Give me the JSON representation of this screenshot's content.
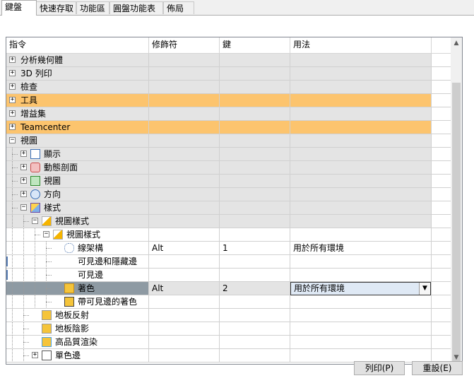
{
  "tabs": [
    {
      "label": "鍵盤"
    },
    {
      "label": "快速存取"
    },
    {
      "label": "功能區"
    },
    {
      "label": "圓盤功能表"
    },
    {
      "label": "佈局"
    }
  ],
  "columns": [
    "指令",
    "修飾符",
    "鍵",
    "用法"
  ],
  "rows": [
    {
      "label": "分析幾何體",
      "modifier": "",
      "key": "",
      "usage": ""
    },
    {
      "label": "3D 列印",
      "modifier": "",
      "key": "",
      "usage": ""
    },
    {
      "label": "檢查",
      "modifier": "",
      "key": "",
      "usage": ""
    },
    {
      "label": "工具",
      "modifier": "",
      "key": "",
      "usage": ""
    },
    {
      "label": "增益集",
      "modifier": "",
      "key": "",
      "usage": ""
    },
    {
      "label": "Teamcenter",
      "modifier": "",
      "key": "",
      "usage": ""
    },
    {
      "label": "視圖",
      "modifier": "",
      "key": "",
      "usage": ""
    },
    {
      "label": "顯示",
      "modifier": "",
      "key": "",
      "usage": ""
    },
    {
      "label": "動態剖面",
      "modifier": "",
      "key": "",
      "usage": ""
    },
    {
      "label": "視圖",
      "modifier": "",
      "key": "",
      "usage": ""
    },
    {
      "label": "方向",
      "modifier": "",
      "key": "",
      "usage": ""
    },
    {
      "label": "樣式",
      "modifier": "",
      "key": "",
      "usage": ""
    },
    {
      "label": "視圖樣式",
      "modifier": "",
      "key": "",
      "usage": ""
    },
    {
      "label": "視圖樣式",
      "modifier": "",
      "key": "",
      "usage": ""
    },
    {
      "label": "線架構",
      "modifier": "Alt",
      "key": "1",
      "usage": "用於所有環境"
    },
    {
      "label": "可見邊和隱藏邊",
      "modifier": "",
      "key": "",
      "usage": ""
    },
    {
      "label": "可見邊",
      "modifier": "",
      "key": "",
      "usage": ""
    },
    {
      "label": "著色",
      "modifier": "Alt",
      "key": "2",
      "usage": "用於所有環境"
    },
    {
      "label": "帶可見邊的著色",
      "modifier": "",
      "key": "",
      "usage": ""
    },
    {
      "label": "地板反射",
      "modifier": "",
      "key": "",
      "usage": ""
    },
    {
      "label": "地板陰影",
      "modifier": "",
      "key": "",
      "usage": ""
    },
    {
      "label": "高品質渲染",
      "modifier": "",
      "key": "",
      "usage": ""
    },
    {
      "label": "單色邊",
      "modifier": "",
      "key": "",
      "usage": ""
    }
  ],
  "buttons": {
    "print": "列印(P)",
    "reset": "重設(E)"
  },
  "colors": {
    "highlight": "#fcc46e",
    "selection": "#8e9aa3"
  },
  "icons": {
    "expand": "+",
    "collapse": "−",
    "scroll_up": "▲",
    "scroll_down": "▼",
    "dropdown": "▼"
  }
}
